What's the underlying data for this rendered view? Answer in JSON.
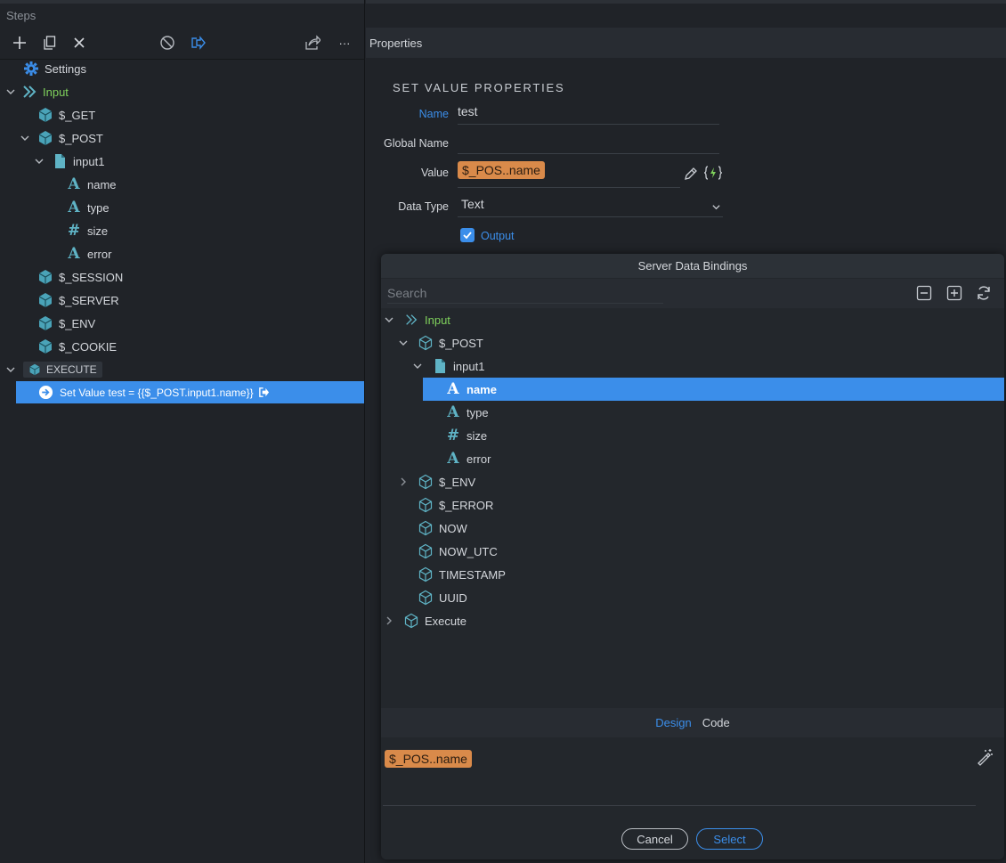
{
  "steps_panel": {
    "title": "Steps",
    "toolbar": {
      "add": "add-icon",
      "duplicate": "duplicate-icon",
      "delete": "close-icon",
      "disable": "disable-icon",
      "output": "output-icon",
      "export": "export-icon",
      "more": "more-icon",
      "more_label": "···"
    },
    "tree": {
      "settings": "Settings",
      "input": "Input",
      "get": "$_GET",
      "post": "$_POST",
      "input1": "input1",
      "name": "name",
      "type": "type",
      "size": "size",
      "error": "error",
      "session": "$_SESSION",
      "server": "$_SERVER",
      "env": "$_ENV",
      "cookie": "$_COOKIE",
      "execute": "EXECUTE",
      "selected_step": "Set Value test = {{$_POST.input1.name}}"
    }
  },
  "properties_panel": {
    "title": "Properties",
    "section_title": "SET VALUE PROPERTIES",
    "fields": {
      "name_label": "Name",
      "name_value": "test",
      "global_name_label": "Global Name",
      "global_name_value": "",
      "value_label": "Value",
      "value_pill": "$_POS..name",
      "data_type_label": "Data Type",
      "data_type_value": "Text",
      "output_label": "Output",
      "output_checked": true
    }
  },
  "dialog": {
    "title": "Server Data Bindings",
    "search_placeholder": "Search",
    "tree": {
      "input": "Input",
      "post": "$_POST",
      "input1": "input1",
      "name": "name",
      "type": "type",
      "size": "size",
      "error": "error",
      "env": "$_ENV",
      "error_global": "$_ERROR",
      "now": "NOW",
      "now_utc": "NOW_UTC",
      "timestamp": "TIMESTAMP",
      "uuid": "UUID",
      "execute": "Execute"
    },
    "tabs": {
      "design": "Design",
      "code": "Code"
    },
    "expression_pill": "$_POS..name",
    "buttons": {
      "cancel": "Cancel",
      "select": "Select"
    }
  },
  "colors": {
    "accent": "#3b8eea",
    "input_green": "#7fd15c",
    "pill_orange": "#d98a4a",
    "icon_teal": "#5fb3c5"
  }
}
